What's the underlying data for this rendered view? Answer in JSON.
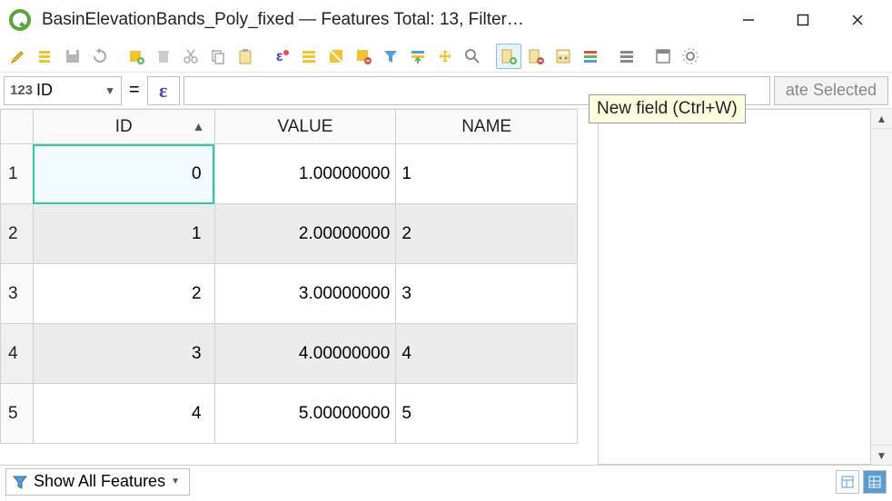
{
  "window": {
    "title": "BasinElevationBands_Poly_fixed — Features Total: 13, Filter…"
  },
  "tooltip": {
    "text": "New field (Ctrl+W)"
  },
  "fieldbar": {
    "type_prefix": "123",
    "field_name": "ID",
    "equals": "=",
    "epsilon": "ε",
    "expression": "",
    "update_label": "ate Selected"
  },
  "table": {
    "columns": [
      "ID",
      "VALUE",
      "NAME"
    ],
    "sort_column": 0,
    "sort_dir": "asc",
    "rows": [
      {
        "n": "1",
        "id": "0",
        "value": "1.00000000",
        "name": "1"
      },
      {
        "n": "2",
        "id": "1",
        "value": "2.00000000",
        "name": "2"
      },
      {
        "n": "3",
        "id": "2",
        "value": "3.00000000",
        "name": "3"
      },
      {
        "n": "4",
        "id": "3",
        "value": "4.00000000",
        "name": "4"
      },
      {
        "n": "5",
        "id": "4",
        "value": "5.00000000",
        "name": "5"
      }
    ],
    "selected": {
      "row": 0,
      "col": "id"
    }
  },
  "statusbar": {
    "show_all_label": "Show All Features"
  },
  "icons": {
    "toolbar": [
      "pencil-icon",
      "multi-edit-icon",
      "save-edits-icon",
      "reload-icon",
      "add-feature-icon",
      "delete-feature-icon",
      "cut-icon",
      "copy-icon",
      "paste-icon",
      "expression-select-icon",
      "select-all-icon",
      "invert-select-icon",
      "deselect-icon",
      "filter-select-icon",
      "move-top-icon",
      "pan-to-icon",
      "zoom-to-icon",
      "new-field-icon",
      "delete-field-icon",
      "field-calc-icon",
      "conditional-format-icon",
      "actions-icon",
      "dock-icon",
      "settings-icon"
    ]
  }
}
